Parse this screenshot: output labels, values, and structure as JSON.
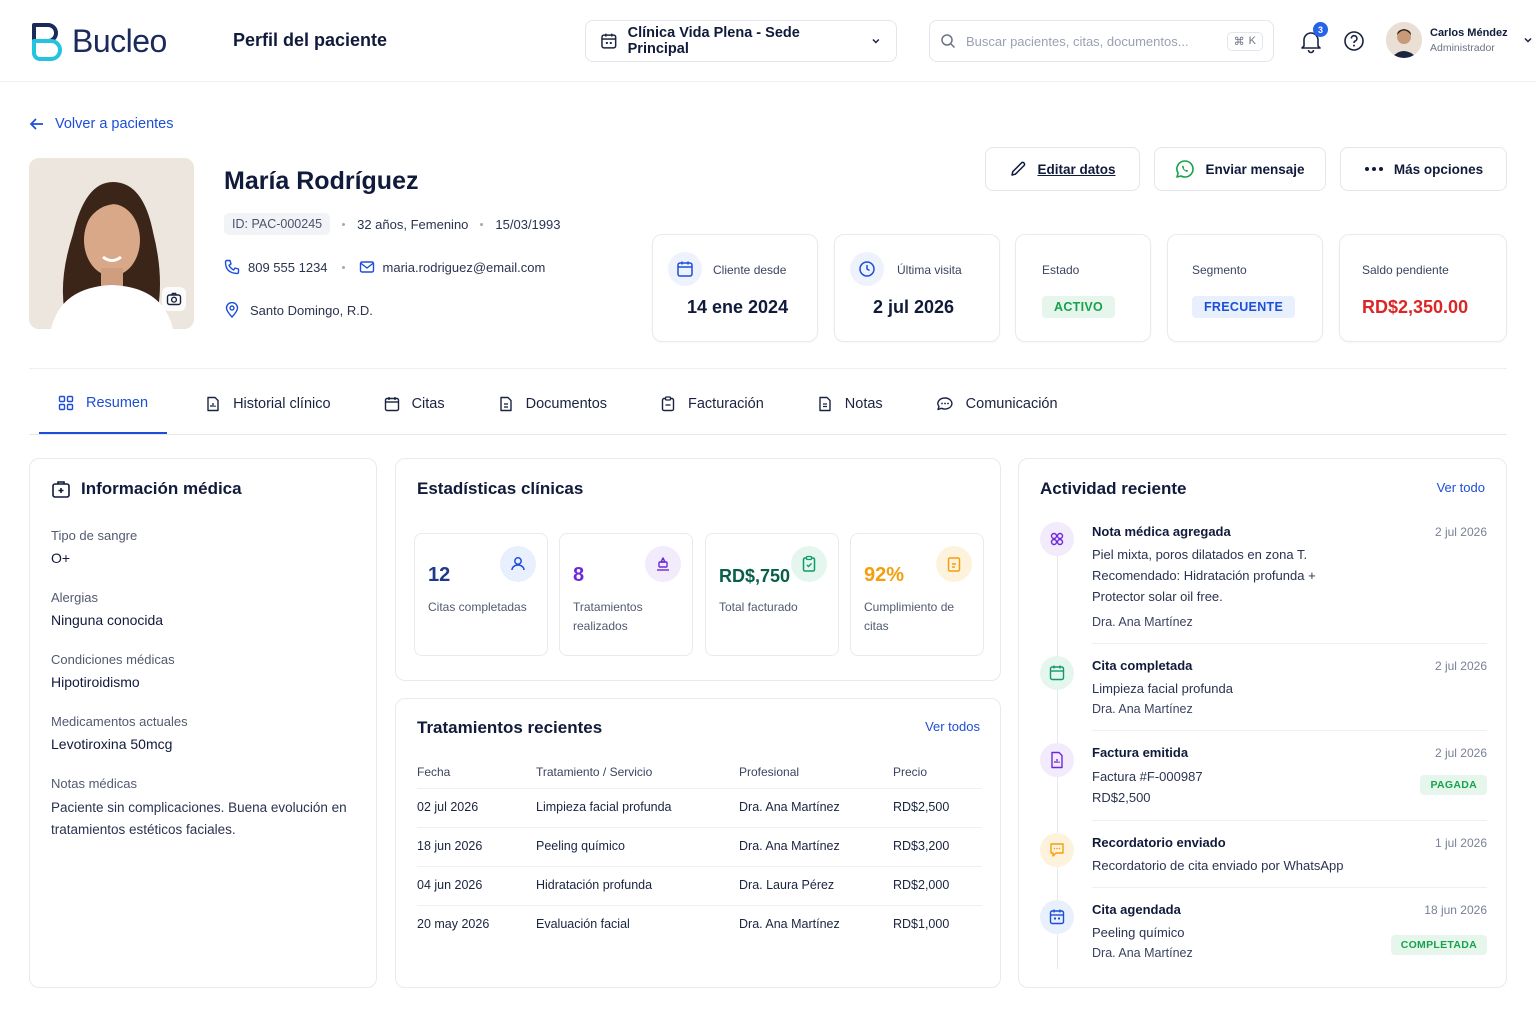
{
  "header": {
    "logo_text": "Bucleo",
    "page_title": "Perfil del paciente",
    "clinic": "Clínica Vida Plena - Sede Principal",
    "search_placeholder": "Buscar pacientes, citas, documentos...",
    "shortcut_mod": "⌘",
    "shortcut_key": "K",
    "notification_count": "3",
    "user_name": "Carlos Méndez",
    "user_role": "Administrador"
  },
  "back_label": "Volver a pacientes",
  "patient": {
    "name": "María Rodríguez",
    "id": "ID: PAC-000245",
    "age_gender": "32 años, Femenino",
    "dob": "15/03/1993",
    "phone": "809 555 1234",
    "email": "maria.rodriguez@email.com",
    "location": "Santo Domingo, R.D."
  },
  "actions": {
    "edit": "Editar datos",
    "message": "Enviar mensaje",
    "more": "Más opciones"
  },
  "summary": {
    "client_since_label": "Cliente desde",
    "client_since": "14 ene 2024",
    "last_visit_label": "Última visita",
    "last_visit": "2 jul 2026",
    "status_label": "Estado",
    "status": "ACTIVO",
    "segment_label": "Segmento",
    "segment": "FRECUENTE",
    "balance_label": "Saldo pendiente",
    "balance": "RD$2,350.00"
  },
  "tabs": [
    "Resumen",
    "Historial clínico",
    "Citas",
    "Documentos",
    "Facturación",
    "Notas",
    "Comunicación"
  ],
  "medical": {
    "title": "Información médica",
    "items": [
      {
        "label": "Tipo de sangre",
        "value": "O+"
      },
      {
        "label": "Alergias",
        "value": "Ninguna conocida"
      },
      {
        "label": "Condiciones médicas",
        "value": "Hipotiroidismo"
      },
      {
        "label": "Medicamentos actuales",
        "value": "Levotiroxina 50mcg"
      },
      {
        "label": "Notas médicas",
        "value": "Paciente sin complicaciones. Buena evolución en tratamientos estéticos faciales."
      }
    ]
  },
  "stats": {
    "title": "Estadísticas clínicas",
    "items": [
      {
        "value": "12",
        "label": "Citas completadas",
        "color": "#1e3a8a"
      },
      {
        "value": "8",
        "label": "Tratamientos realizados",
        "color": "#6d28d9"
      },
      {
        "value": "RD$,750",
        "label": "Total facturado",
        "color": "#065f46"
      },
      {
        "value": "92%",
        "label": "Cumplimiento de citas",
        "color": "#f59e0b"
      }
    ]
  },
  "treatments": {
    "title": "Tratamientos recientes",
    "link": "Ver todos",
    "columns": [
      "Fecha",
      "Tratamiento / Servicio",
      "Profesional",
      "Precio"
    ],
    "rows": [
      [
        "02 jul 2026",
        "Limpieza facial profunda",
        "Dra. Ana Martínez",
        "RD$2,500"
      ],
      [
        "18 jun 2026",
        "Peeling químico",
        "Dra. Ana Martínez",
        "RD$3,200"
      ],
      [
        "04 jun 2026",
        "Hidratación profunda",
        "Dra. Laura Pérez",
        "RD$2,000"
      ],
      [
        "20 may 2026",
        "Evaluación facial",
        "Dra. Ana Martínez",
        "RD$1,000"
      ]
    ]
  },
  "activity": {
    "title": "Actividad reciente",
    "link": "Ver todo",
    "items": [
      {
        "title": "Nota médica agregada",
        "date": "2 jul 2026",
        "lines": [
          "Piel mixta, poros dilatados en zona T.",
          "Recomendado: Hidratación profunda +",
          "Protector solar oil free.",
          "Dra. Ana Martínez"
        ]
      },
      {
        "title": "Cita completada",
        "date": "2 jul 2026",
        "lines": [
          "Limpieza facial profunda",
          "Dra. Ana Martínez"
        ]
      },
      {
        "title": "Factura emitida",
        "date": "2 jul 2026",
        "lines": [
          "Factura #F-000987",
          "RD$2,500"
        ],
        "badge": "PAGADA"
      },
      {
        "title": "Recordatorio enviado",
        "date": "1 jul 2026",
        "lines": [
          "Recordatorio de cita enviado por WhatsApp"
        ]
      },
      {
        "title": "Cita agendada",
        "date": "18 jun 2026",
        "lines": [
          "Peeling químico",
          "Dra. Ana Martínez"
        ],
        "badge": "COMPLETADA"
      }
    ]
  },
  "colors": {
    "primary": "#1d4ed8",
    "active_green": "#16a34a",
    "balance_red": "#dc2626"
  }
}
